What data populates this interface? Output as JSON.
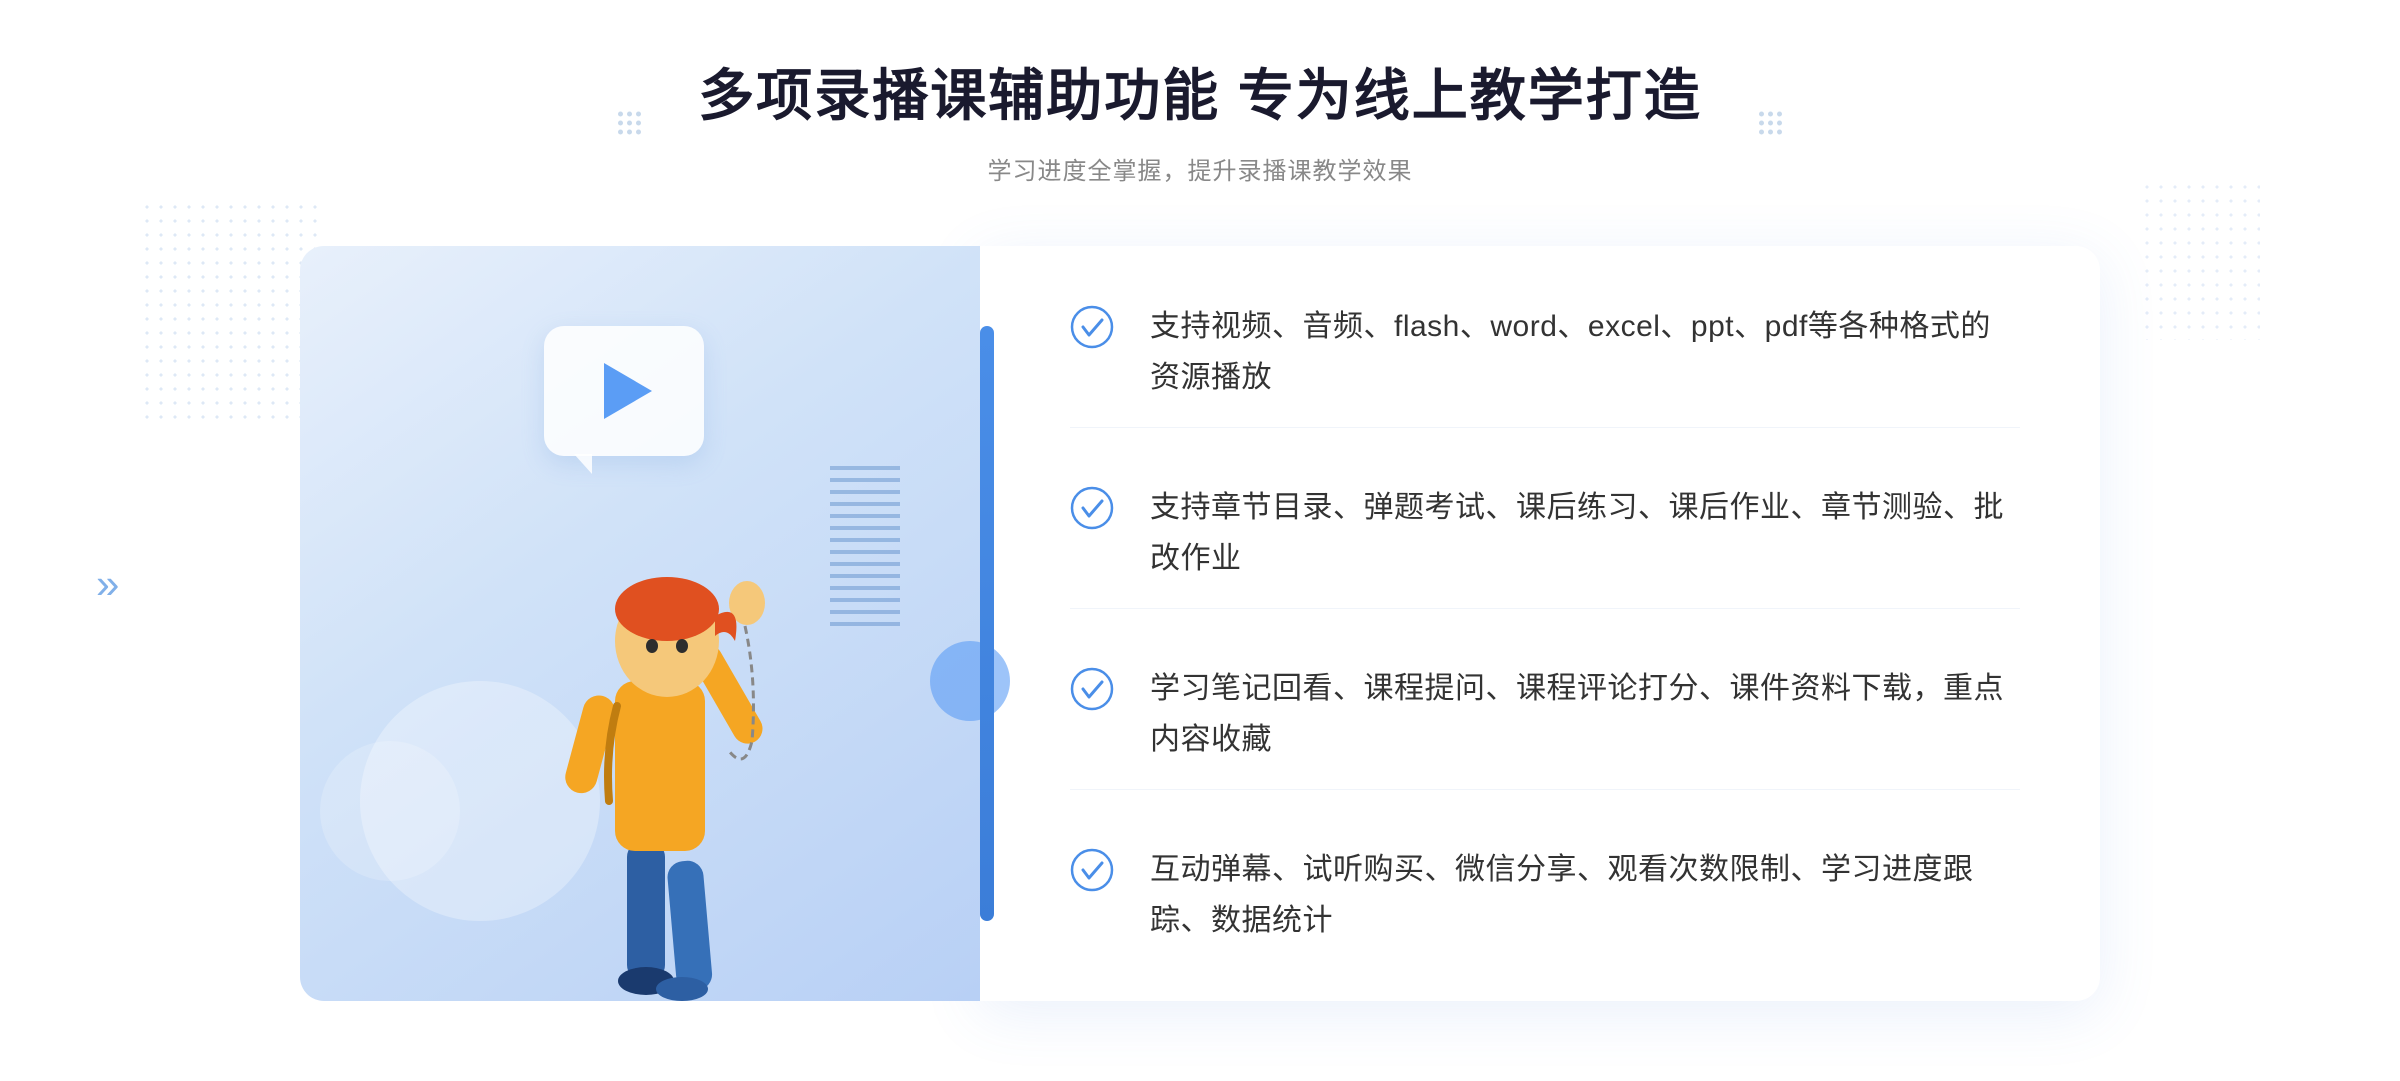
{
  "header": {
    "title": "多项录播课辅助功能 专为线上教学打造",
    "subtitle": "学习进度全掌握，提升录播课教学效果"
  },
  "features": [
    {
      "id": 1,
      "text": "支持视频、音频、flash、word、excel、ppt、pdf等各种格式的资源播放"
    },
    {
      "id": 2,
      "text": "支持章节目录、弹题考试、课后练习、课后作业、章节测验、批改作业"
    },
    {
      "id": 3,
      "text": "学习笔记回看、课程提问、课程评论打分、课件资料下载，重点内容收藏"
    },
    {
      "id": 4,
      "text": "互动弹幕、试听购买、微信分享、观看次数限制、学习进度跟踪、数据统计"
    }
  ],
  "icons": {
    "check": "✓",
    "play": "▶",
    "chevron": "»"
  },
  "colors": {
    "primary": "#4a8ee8",
    "title": "#1a1a2e",
    "text": "#333333",
    "subtitle": "#888888",
    "checkColor": "#4a8ee8"
  }
}
